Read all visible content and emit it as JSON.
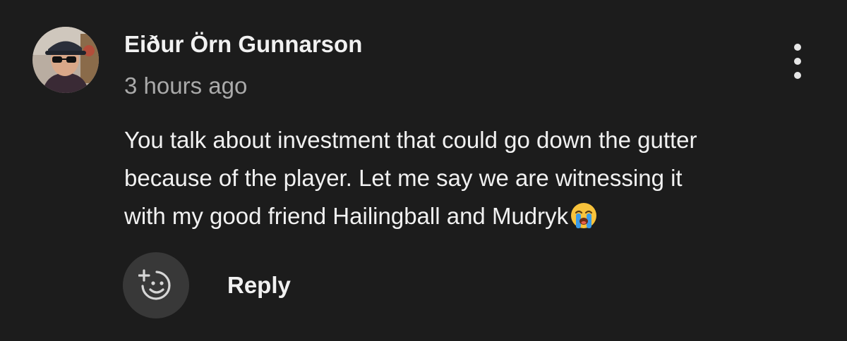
{
  "comment": {
    "author": "Eiður Örn Gunnarson",
    "timestamp": "3 hours ago",
    "text_lines": [
      "You talk about investment that could go down the gutter",
      "because of the player. Let me say we are witnessing it",
      "with my good friend Hailingball and Mudryk"
    ],
    "emoji": "loudly-crying-face-emoji"
  },
  "actions": {
    "reaction_icon": "add-reaction-icon",
    "reply_label": "Reply",
    "more_icon": "more-vertical-icon"
  },
  "colors": {
    "background": "#1c1c1c",
    "text_primary": "#f1f1f1",
    "text_secondary": "#aaaaaa",
    "reaction_button_bg": "#383838"
  }
}
